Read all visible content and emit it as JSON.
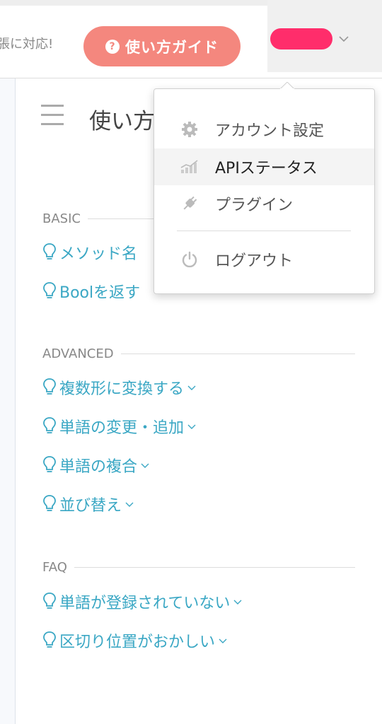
{
  "header": {
    "tagline": "張に対応!",
    "guide_button": "使い方ガイド",
    "guide_icon": "question-circle-icon"
  },
  "page": {
    "title": "使い方"
  },
  "sections": [
    {
      "label": "BASIC",
      "items": [
        "メソッド名",
        "Boolを返す"
      ]
    },
    {
      "label": "ADVANCED",
      "items": [
        "複数形に変換する",
        "単語の変更・追加",
        "単語の複合",
        "並び替え"
      ]
    },
    {
      "label": "FAQ",
      "items": [
        "単語が登録されていない",
        "区切り位置がおかしい"
      ]
    }
  ],
  "account_menu": {
    "items": [
      {
        "label": "アカウント設定",
        "icon": "gear-icon"
      },
      {
        "label": "APIステータス",
        "icon": "signal-bars-icon"
      },
      {
        "label": "プラグイン",
        "icon": "plug-icon"
      },
      {
        "label": "ログアウト",
        "icon": "power-icon"
      }
    ]
  },
  "colors": {
    "accent_pink": "#ff2d6b",
    "guide_button": "#f4877e",
    "link_blue": "#3aa7c4"
  }
}
